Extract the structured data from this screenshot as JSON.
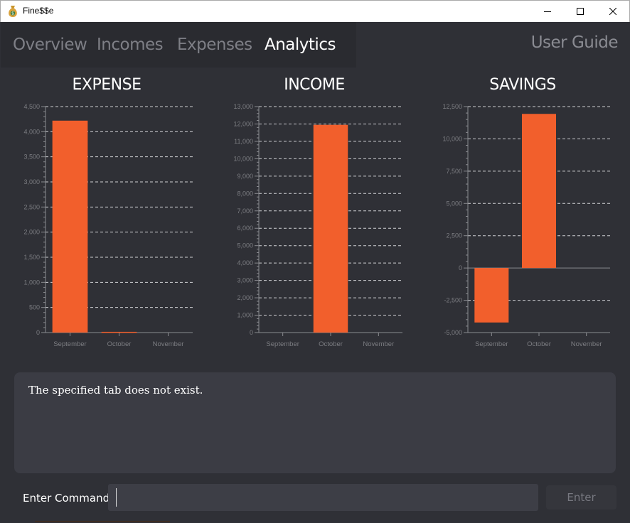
{
  "window": {
    "title": "Fine$$e"
  },
  "tabs": [
    {
      "label": "Overview",
      "active": false
    },
    {
      "label": "Incomes",
      "active": false
    },
    {
      "label": "Expenses",
      "active": false
    },
    {
      "label": "Analytics",
      "active": true
    }
  ],
  "user_guide_label": "User Guide",
  "colors": {
    "bar": "#f25f2c",
    "background": "#2f3036",
    "active_tab": "#ffffff",
    "inactive_tab": "#7e7f86"
  },
  "chart_data": [
    {
      "type": "bar",
      "title": "EXPENSE",
      "categories": [
        "September",
        "October",
        "November"
      ],
      "values": [
        4220,
        15,
        0
      ],
      "ylim": [
        0,
        4500
      ],
      "yticks": [
        0,
        500,
        1000,
        1500,
        2000,
        2500,
        3000,
        3500,
        4000,
        4500
      ],
      "ytick_labels": [
        "0",
        "500",
        "1,000",
        "1,500",
        "2,000",
        "2,500",
        "3,000",
        "3,500",
        "4,000",
        "4,500"
      ],
      "grid": true
    },
    {
      "type": "bar",
      "title": "INCOME",
      "categories": [
        "September",
        "October",
        "November"
      ],
      "values": [
        0,
        11950,
        0
      ],
      "ylim": [
        0,
        13000
      ],
      "yticks": [
        0,
        1000,
        2000,
        3000,
        4000,
        5000,
        6000,
        7000,
        8000,
        9000,
        10000,
        11000,
        12000,
        13000
      ],
      "ytick_labels": [
        "0",
        "1,000",
        "2,000",
        "3,000",
        "4,000",
        "5,000",
        "6,000",
        "7,000",
        "8,000",
        "9,000",
        "10,000",
        "11,000",
        "12,000",
        "13,000"
      ],
      "grid": true
    },
    {
      "type": "bar",
      "title": "SAVINGS",
      "categories": [
        "September",
        "October",
        "November"
      ],
      "values": [
        -4220,
        11935,
        0
      ],
      "ylim": [
        -5000,
        12500
      ],
      "yticks": [
        -5000,
        -2500,
        0,
        2500,
        5000,
        7500,
        10000,
        12500
      ],
      "ytick_labels": [
        "-5,000",
        "-2,500",
        "0",
        "2,500",
        "5,000",
        "7,500",
        "10,000",
        "12,500"
      ],
      "grid": true
    }
  ],
  "result": {
    "message": "The specified tab does not exist."
  },
  "command": {
    "label": "Enter Command:",
    "value": "",
    "button_label": "Enter"
  },
  "icons": {
    "app": "money-bag-icon",
    "minimize": "minimize-icon",
    "maximize": "maximize-icon",
    "close": "close-icon"
  }
}
